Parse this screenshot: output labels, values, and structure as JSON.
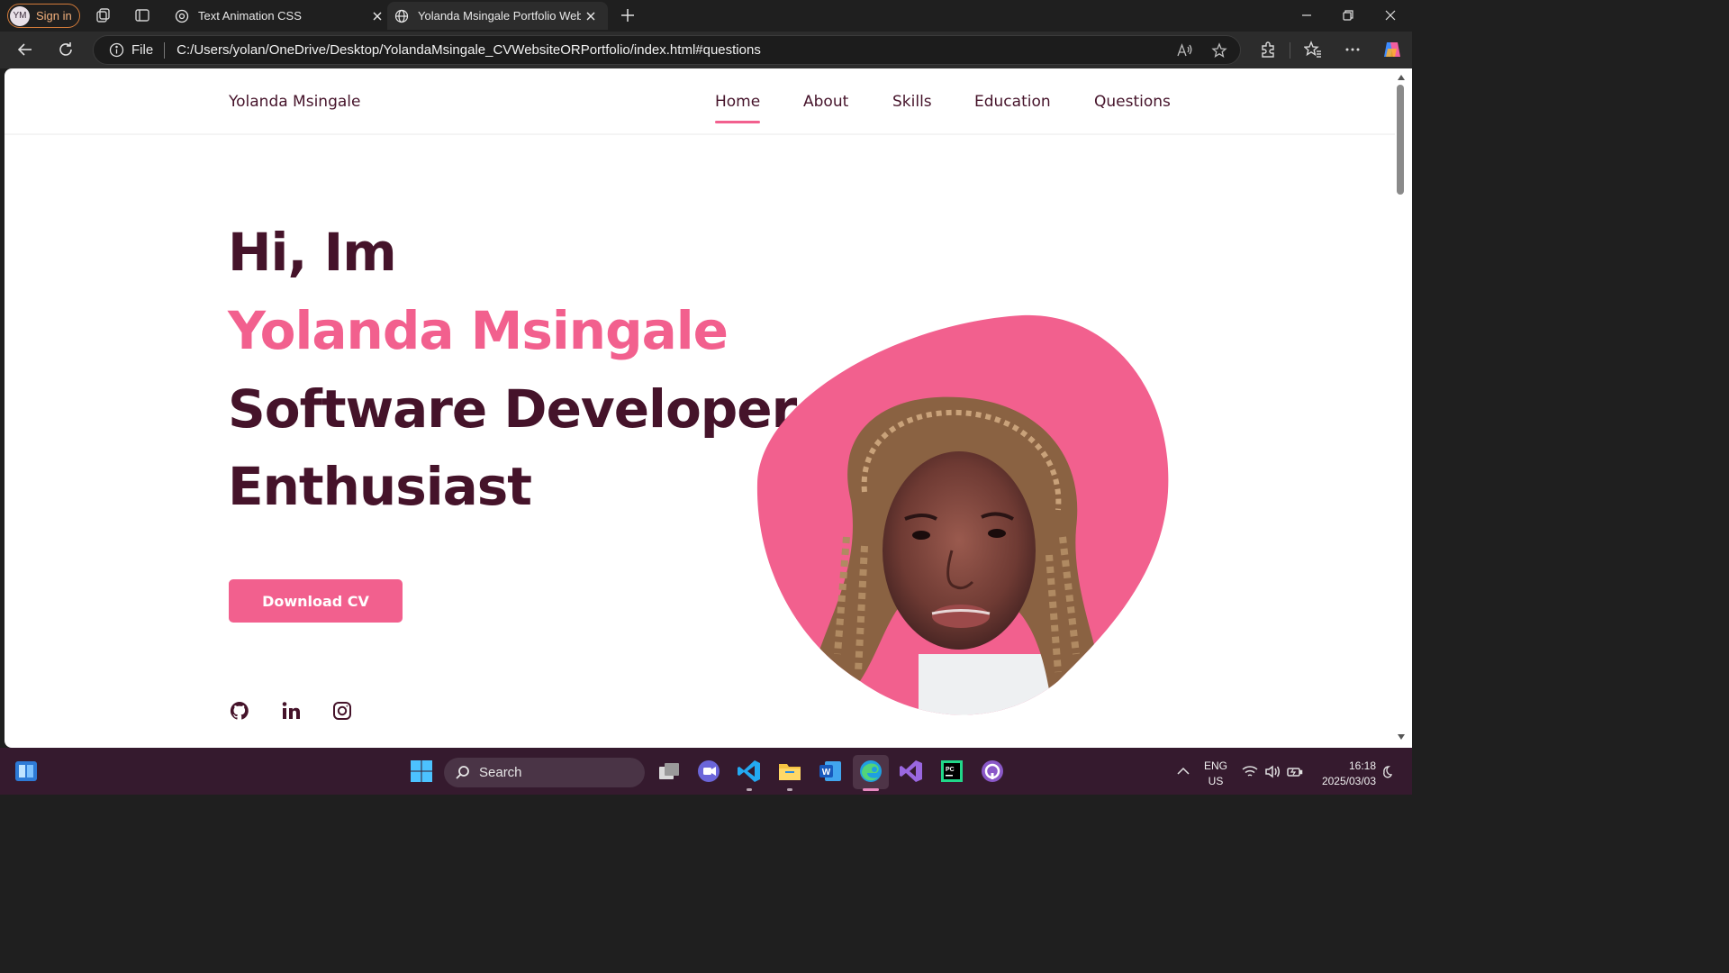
{
  "browser": {
    "profile_initials": "YM",
    "signin_label": "Sign in",
    "tabs": [
      {
        "title": "Text Animation CSS",
        "icon": "chatgpt-icon"
      },
      {
        "title": "Yolanda Msingale Portfolio Website",
        "icon": "globe-icon"
      }
    ],
    "address": {
      "scheme_label": "File",
      "url": "C:/Users/yolan/OneDrive/Desktop/YolandaMsingale_CVWebsiteORPortfolio/index.html#questions"
    }
  },
  "site": {
    "logo": "Yolanda Msingale",
    "nav": [
      {
        "label": "Home",
        "active": true
      },
      {
        "label": "About"
      },
      {
        "label": "Skills"
      },
      {
        "label": "Education"
      },
      {
        "label": "Questions"
      }
    ],
    "hero": {
      "greeting": "Hi, Im",
      "name": "Yolanda Msingale",
      "role_line1": "Software Developer",
      "role_line2": "Enthusiast"
    },
    "cv_button": "Download CV",
    "socials": [
      "github-icon",
      "linkedin-icon",
      "instagram-icon"
    ],
    "colors": {
      "accent": "#f2608e",
      "dark": "#45132a"
    }
  },
  "taskbar": {
    "search_label": "Search",
    "language": "ENG",
    "region": "US",
    "time": "16:18",
    "date": "2025/03/03"
  }
}
